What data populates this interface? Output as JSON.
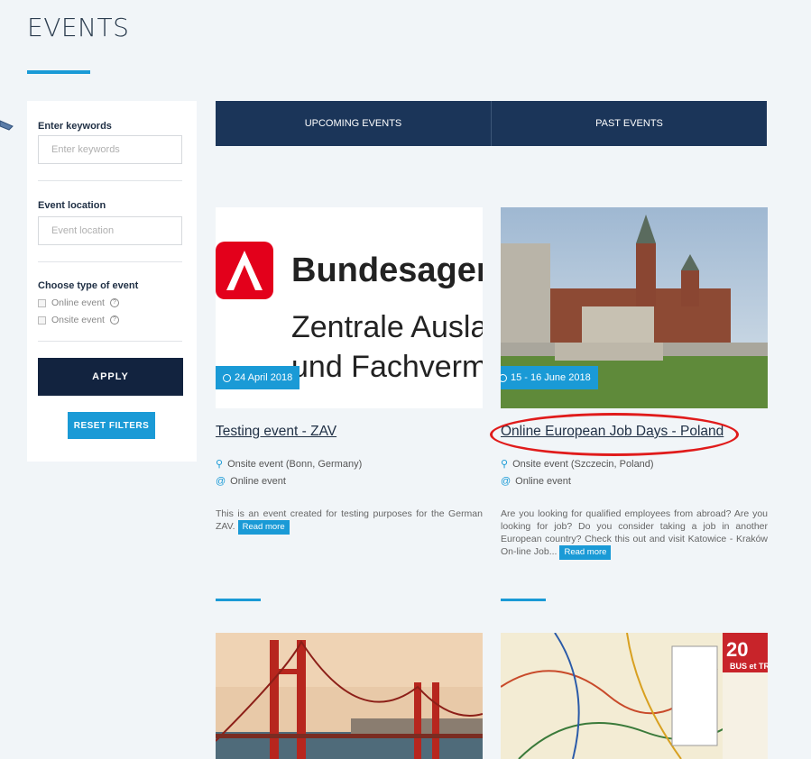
{
  "page": {
    "title": "EVENTS"
  },
  "sidebar": {
    "keywords_label": "Enter keywords",
    "keywords_placeholder": "Enter keywords",
    "location_label": "Event location",
    "location_placeholder": "Event location",
    "type_label": "Choose type of event",
    "type_options": [
      "Online event",
      "Onsite event"
    ],
    "apply_label": "APPLY",
    "reset_label": "RESET FILTERS"
  },
  "tabs": [
    {
      "label": "UPCOMING EVENTS"
    },
    {
      "label": "PAST EVENTS"
    }
  ],
  "events": [
    {
      "date": "24 April 2018",
      "title": "Testing event - ZAV",
      "onsite": "Onsite event (Bonn, Germany)",
      "online": "Online event",
      "description": "This is an event created for testing purposes for the German ZAV.",
      "read_more": "Read more",
      "image_text": {
        "line1": "Bundesagen",
        "line2": "Zentrale Auslan",
        "line3": "und Fachvermi"
      }
    },
    {
      "date": "15 - 16 June 2018",
      "title": "Online European Job Days - Poland",
      "onsite": "Onsite event (Szczecin, Poland)",
      "online": "Online event",
      "description": "Are you looking for qualified employees from abroad? Are you looking for job? Do you consider taking a job in another European country? Check this out and visit Katowice - Kraków On-line Job...",
      "read_more": "Read more"
    }
  ],
  "map_badge": {
    "number": "20",
    "text": "BUS et TR"
  },
  "colors": {
    "navy": "#1b3559",
    "dark_navy": "#12233f",
    "accent": "#1a9ad6",
    "highlight": "#e01b1b"
  },
  "icons": {
    "location": "map-pin-icon",
    "online": "at-icon",
    "clock": "clock-icon",
    "help": "help-circle-icon"
  }
}
